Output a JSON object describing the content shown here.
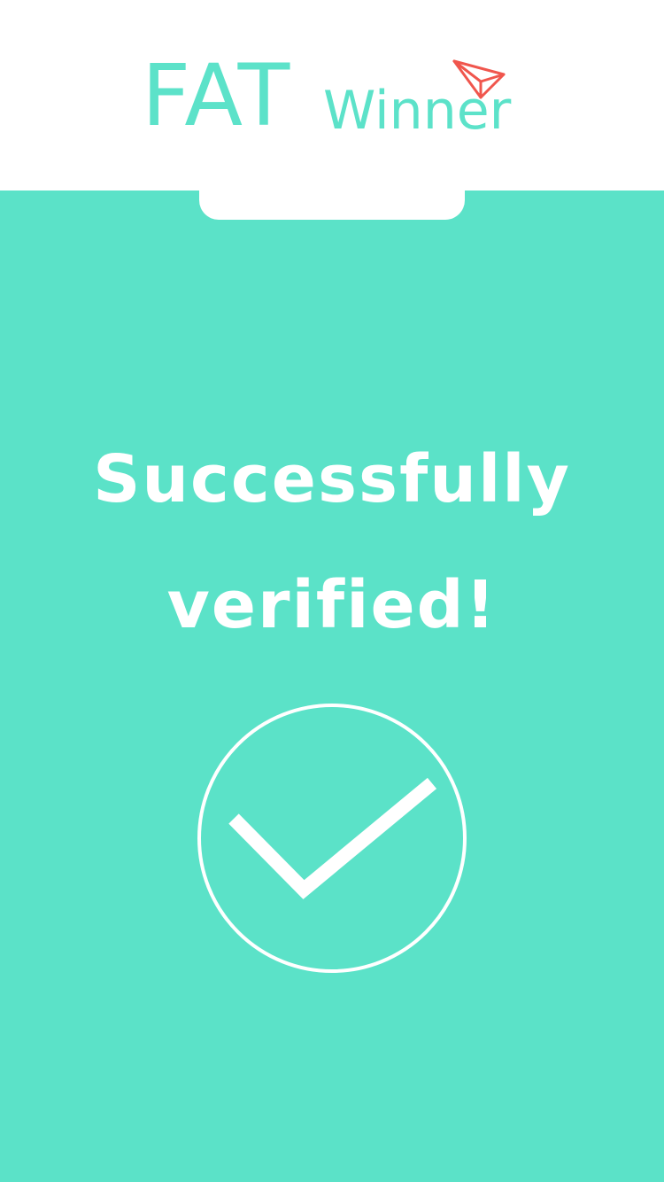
{
  "header": {
    "logo_primary": "FAT",
    "logo_secondary": "Winner",
    "logo_icon": "paper-plane-icon"
  },
  "status": {
    "line1": "Successfully",
    "line2": "verified!",
    "icon": "checkmark-circle-icon"
  },
  "colors": {
    "brand": "#5ce2c9",
    "panel": "#5be2c8",
    "plane": "#f0564d",
    "text_on_panel": "#ffffff"
  }
}
